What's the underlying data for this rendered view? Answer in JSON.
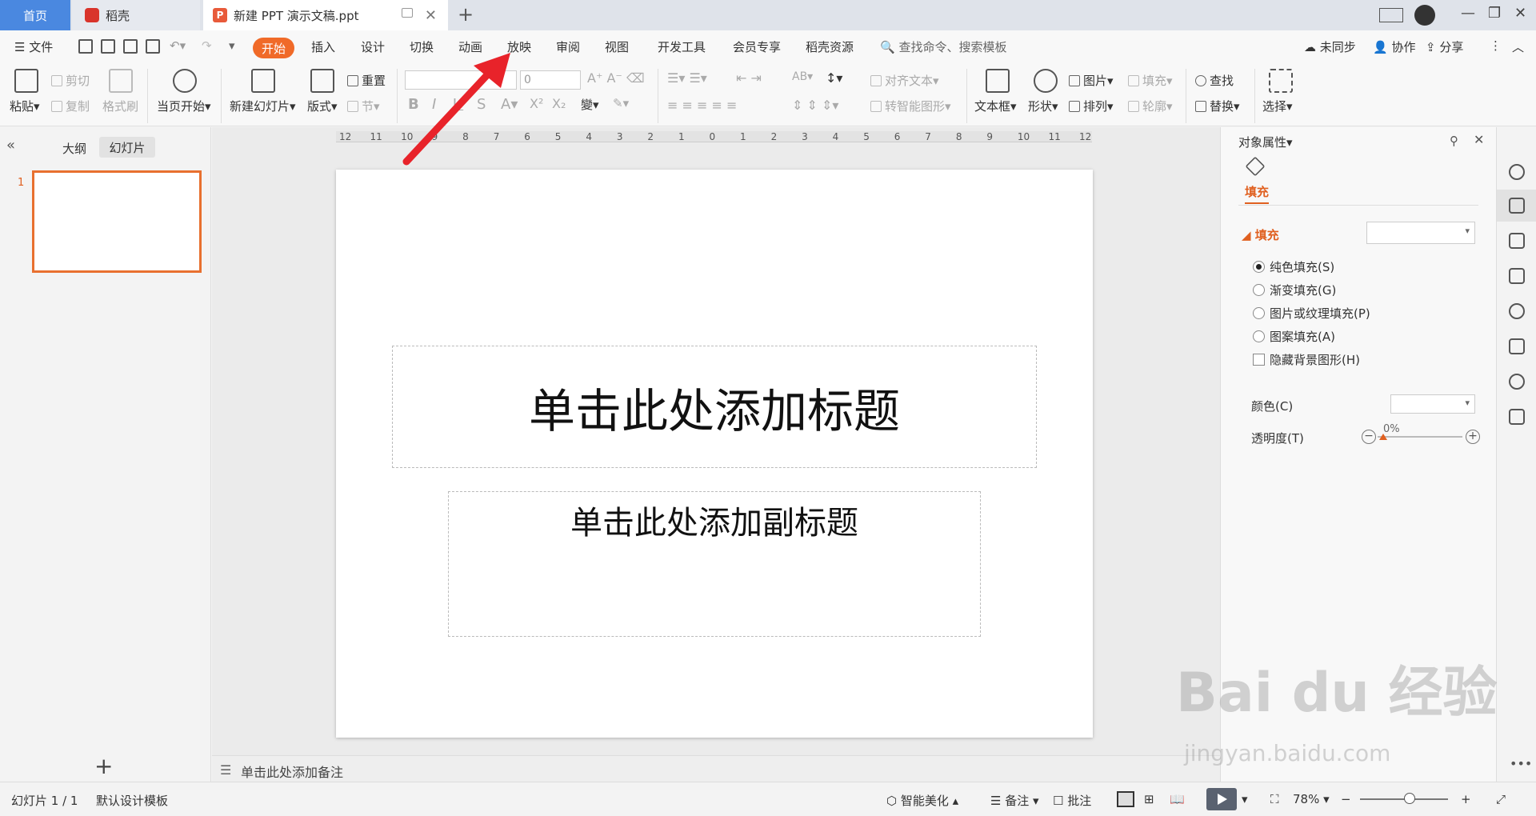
{
  "tabs": {
    "home": "首页",
    "daoke": "稻壳",
    "doc": "新建 PPT 演示文稿.ppt",
    "doc_icon": "P"
  },
  "menu": {
    "file": "文件",
    "items": [
      "开始",
      "插入",
      "设计",
      "切换",
      "动画",
      "放映",
      "审阅",
      "视图",
      "开发工具",
      "会员专享",
      "稻壳资源"
    ],
    "search": "查找命令、搜索模板",
    "unsync": "未同步",
    "collab": "协作",
    "share": "分享"
  },
  "ribbon": {
    "paste": "粘贴",
    "cut": "剪切",
    "copy": "复制",
    "format_painter": "格式刷",
    "from_current": "当页开始",
    "new_slide": "新建幻灯片",
    "layout": "版式",
    "reset": "重置",
    "section": "节",
    "font_size": "0",
    "align_text": "对齐文本",
    "smart_shape": "转智能图形",
    "textbox": "文本框",
    "shape": "形状",
    "picture": "图片",
    "arrange": "排列",
    "fill": "填充",
    "outline": "轮廓",
    "find": "查找",
    "replace": "替换",
    "select": "选择"
  },
  "left_panel": {
    "outline_tab": "大纲",
    "slides_tab": "幻灯片",
    "slide_number": "1"
  },
  "slide": {
    "title_placeholder": "单击此处添加标题",
    "subtitle_placeholder": "单击此处添加副标题"
  },
  "ruler": [
    "12",
    "11",
    "10",
    "9",
    "8",
    "7",
    "6",
    "5",
    "4",
    "3",
    "2",
    "1",
    "0",
    "1",
    "2",
    "3",
    "4",
    "5",
    "6",
    "7",
    "8",
    "9",
    "10",
    "11",
    "12"
  ],
  "notes": "单击此处添加备注",
  "properties": {
    "title": "对象属性",
    "fill_tab": "填充",
    "fill_section": "填充",
    "options": [
      "纯色填充(S)",
      "渐变填充(G)",
      "图片或纹理填充(P)",
      "图案填充(A)"
    ],
    "hide_bg": "隐藏背景图形(H)",
    "color_label": "颜色(C)",
    "transparency_label": "透明度(T)",
    "transparency_value": "0%"
  },
  "status": {
    "slide_count": "幻灯片 1 / 1",
    "template": "默认设计模板",
    "beautify": "智能美化",
    "notes": "备注",
    "comments": "批注",
    "zoom": "78%"
  },
  "watermark": {
    "logo": "Bai du 经验",
    "url": "jingyan.baidu.com"
  },
  "colors": {
    "accent": "#f06a28",
    "home_tab": "#4a88e0",
    "arrow": "#e8232a"
  }
}
